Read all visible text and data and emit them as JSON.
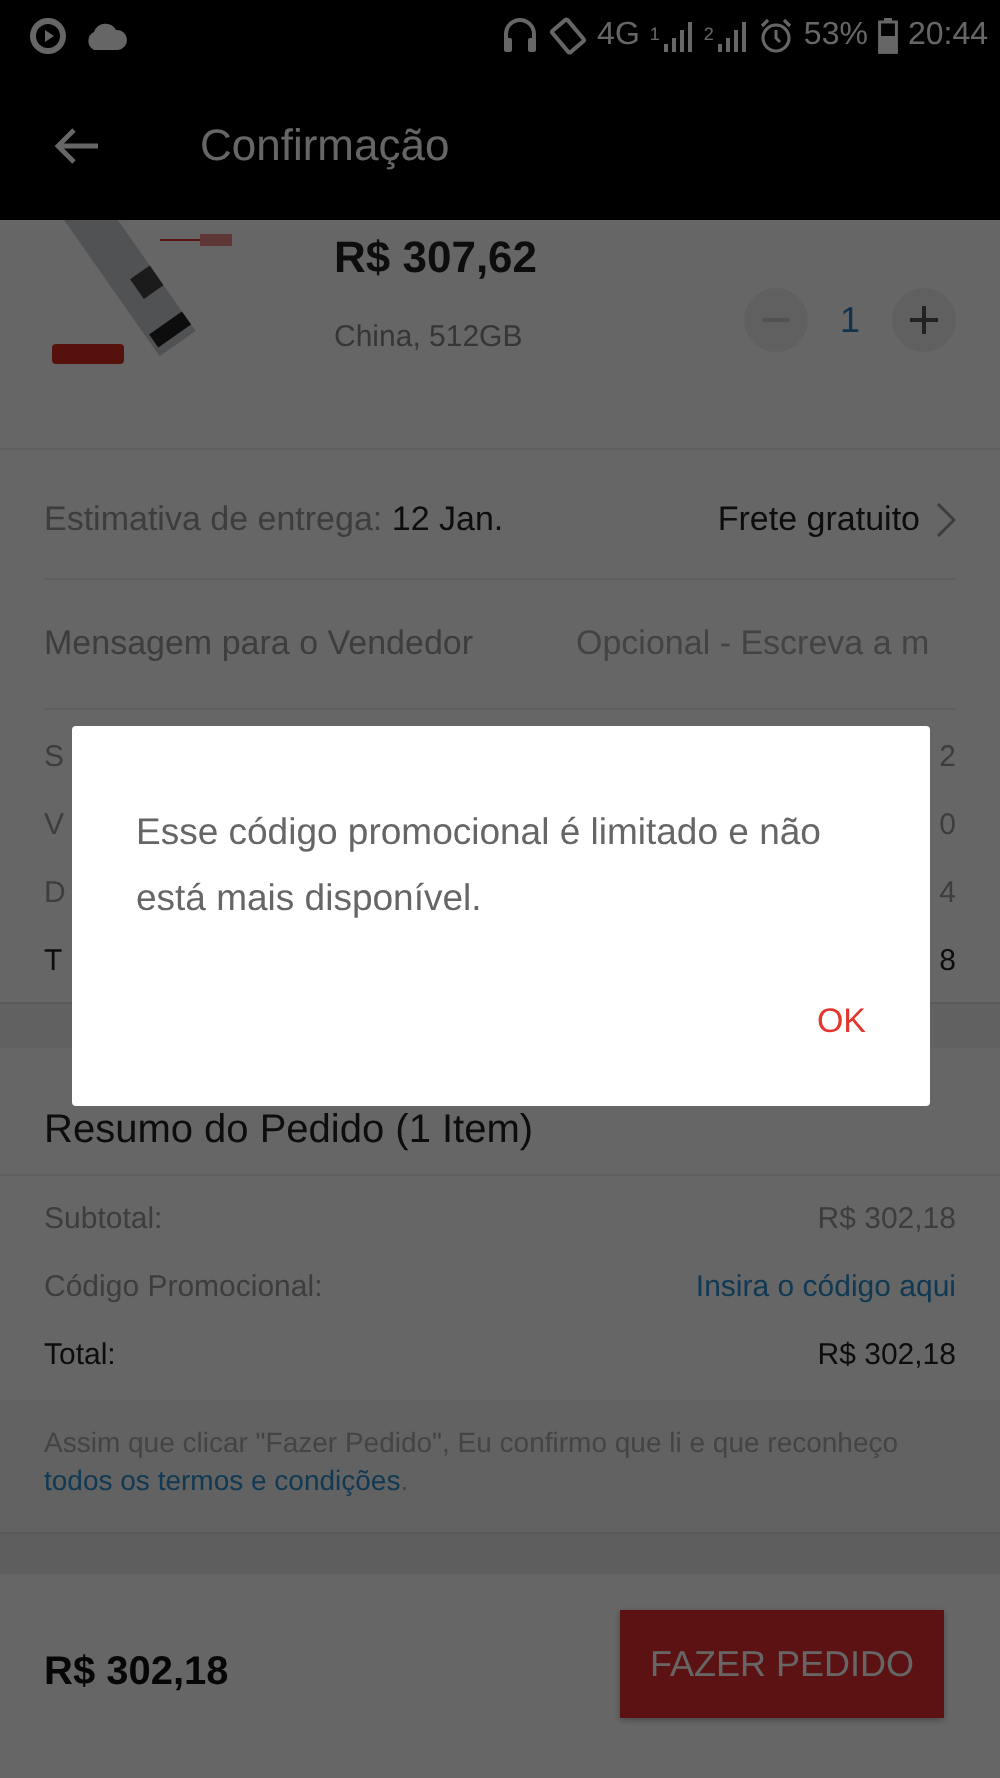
{
  "status_bar": {
    "network": "4G",
    "sims": [
      "1",
      "2"
    ],
    "battery": "53%",
    "time": "20:44"
  },
  "header": {
    "title": "Confirmação"
  },
  "product": {
    "kind": "picture",
    "price": "R$ 307,62",
    "variant": "China, 512GB",
    "quantity": "1"
  },
  "delivery": {
    "label": "Estimativa de entrega:",
    "date": "12 Jan.",
    "shipping": "Frete gratuito"
  },
  "message": {
    "label": "Mensagem para o Vendedor",
    "placeholder": "Opcional - Escreva a m"
  },
  "store_summary": {
    "rows": [
      {
        "label": "S",
        "value": "2",
        "kind": "muted"
      },
      {
        "label": "V",
        "value": "0",
        "kind": "muted"
      },
      {
        "label": "D",
        "value": "4",
        "kind": "muted"
      },
      {
        "label": "T",
        "value": "8",
        "kind": "total"
      }
    ]
  },
  "order_summary": {
    "title": "Resumo do Pedido (1 Item)",
    "rows": [
      {
        "label": "Subtotal:",
        "value": "R$ 302,18",
        "kind": "muted"
      },
      {
        "label": "Código Promocional:",
        "value": "Insira o código aqui",
        "kind": "link"
      },
      {
        "label": "Total:",
        "value": "R$ 302,18",
        "kind": "total"
      }
    ]
  },
  "disclaimer": {
    "text": "Assim que clicar \"Fazer Pedido\", Eu confirmo que li e que reconheço",
    "link": "todos os termos e condições",
    "end": "."
  },
  "footer": {
    "total": "R$ 302,18",
    "button": "FAZER PEDIDO"
  },
  "dialog": {
    "message": "Esse código promocional é limitado e não está mais disponível.",
    "button": "OK"
  }
}
